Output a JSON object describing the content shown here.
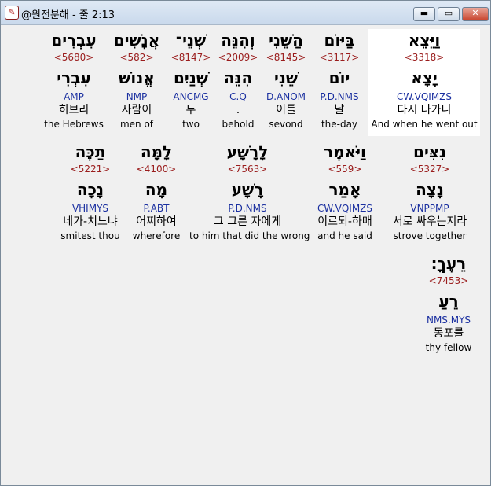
{
  "window": {
    "title": "@원전분해 - 줄 2:13",
    "min_glyph": "▬",
    "max_glyph": "▭",
    "close_glyph": "✕"
  },
  "words": [
    {
      "heb": "וַיֵּצֵא",
      "strong": "<3318>",
      "lemma": "יָצָא",
      "parse": "CW.VQIMZS",
      "kor": "다시 나가니",
      "eng": "And when he went out"
    },
    {
      "heb": "בַּיּוֹם",
      "strong": "<3117>",
      "lemma": "יוֹם",
      "parse": "P.D.NMS",
      "kor": "날",
      "eng": "the-day"
    },
    {
      "heb": "הַשֵּׁנִי",
      "strong": "<8145>",
      "lemma": "שֵׁנִי",
      "parse": "D.ANOM",
      "kor": "이틀",
      "eng": "sevond"
    },
    {
      "heb": "וְהִנֵּה",
      "strong": "<2009>",
      "lemma": "הִנֵּה",
      "parse": "C.Q",
      "kor": ".",
      "eng": "behold"
    },
    {
      "heb": "שְׁנֵי־",
      "strong": "<8147>",
      "lemma": "שְׁנַיִם",
      "parse": "ANCMG",
      "kor": "두",
      "eng": "two"
    },
    {
      "heb": "אֲנָשִׁים",
      "strong": "<582>",
      "lemma": "אֱנוֹשׁ",
      "parse": "NMP",
      "kor": "사람이",
      "eng": "men of"
    },
    {
      "heb": "עִבְרִים",
      "strong": "<5680>",
      "lemma": "עִבְרִי",
      "parse": "AMP",
      "kor": "히브리",
      "eng": "the Hebrews"
    },
    {
      "heb": "נִצִּים",
      "strong": "<5327>",
      "lemma": "נָצָה",
      "parse": "VNPPMP",
      "kor": "서로 싸우는지라",
      "eng": "strove together"
    },
    {
      "heb": "וַיֹּאמֶר",
      "strong": "<559>",
      "lemma": "אָמַר",
      "parse": "CW.VQIMZS",
      "kor": "이르되-하매",
      "eng": "and he said"
    },
    {
      "heb": "לָרָשָׁע",
      "strong": "<7563>",
      "lemma": "רָשָׁע",
      "parse": "P.D.NMS",
      "kor": "그 그른 자에게",
      "eng": "to him that did the wrong"
    },
    {
      "heb": "לָמָּה",
      "strong": "<4100>",
      "lemma": "מָה",
      "parse": "P.ABT",
      "kor": "어찌하여",
      "eng": "wherefore"
    },
    {
      "heb": "תַכֶּה",
      "strong": "<5221>",
      "lemma": "נָכָה",
      "parse": "VHIMYS",
      "kor": "네가-치느냐",
      "eng": "smitest thou"
    },
    {
      "heb": "רֵעֶךָ׃",
      "strong": "<7453>",
      "lemma": "רֵעַ",
      "parse": "NMS.MYS",
      "kor": "동포를",
      "eng": "thy fellow"
    }
  ]
}
